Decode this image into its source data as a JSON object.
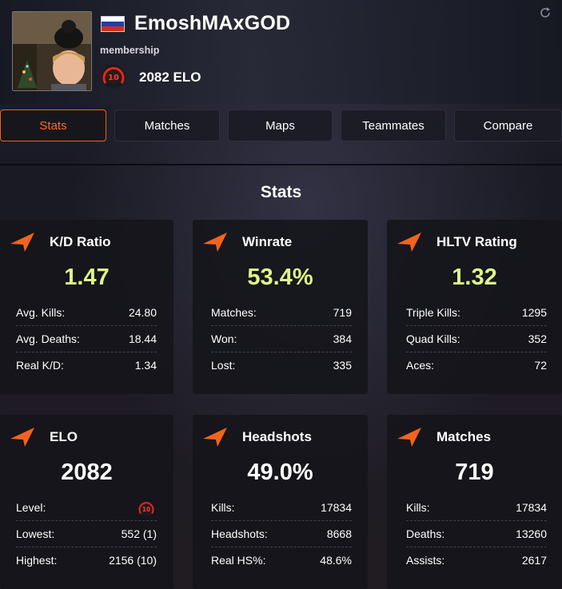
{
  "profile": {
    "nickname": "EmoshMAxGOD",
    "membership": "membership",
    "elo_display": "2082 ELO",
    "level": "10",
    "country": "russia"
  },
  "icons": {
    "refresh": "refresh-icon",
    "card": "faceit-arrow-icon"
  },
  "colors": {
    "accent": "#f2641c",
    "highlight_green": "#dff58a",
    "background": "#1c1c26"
  },
  "tabs": [
    {
      "label": "Stats",
      "active": true
    },
    {
      "label": "Matches",
      "active": false
    },
    {
      "label": "Maps",
      "active": false
    },
    {
      "label": "Teammates",
      "active": false
    },
    {
      "label": "Compare",
      "active": false
    }
  ],
  "section_title": "Stats",
  "cards": [
    {
      "title": "K/D Ratio",
      "value": "1.47",
      "rows": [
        {
          "label": "Avg. Kills:",
          "value": "24.80"
        },
        {
          "label": "Avg. Deaths:",
          "value": "18.44"
        },
        {
          "label": "Real K/D:",
          "value": "1.34"
        }
      ]
    },
    {
      "title": "Winrate",
      "value": "53.4%",
      "rows": [
        {
          "label": "Matches:",
          "value": "719"
        },
        {
          "label": "Won:",
          "value": "384"
        },
        {
          "label": "Lost:",
          "value": "335"
        }
      ]
    },
    {
      "title": "HLTV Rating",
      "value": "1.32",
      "rows": [
        {
          "label": "Triple Kills:",
          "value": "1295"
        },
        {
          "label": "Quad Kills:",
          "value": "352"
        },
        {
          "label": "Aces:",
          "value": "72"
        }
      ]
    },
    {
      "title": "ELO",
      "value": "2082",
      "rows": [
        {
          "label": "Level:",
          "value": "10"
        },
        {
          "label": "Lowest:",
          "value": "552 (1)"
        },
        {
          "label": "Highest:",
          "value": "2156 (10)"
        }
      ]
    },
    {
      "title": "Headshots",
      "value": "49.0%",
      "rows": [
        {
          "label": "Kills:",
          "value": "17834"
        },
        {
          "label": "Headshots:",
          "value": "8668"
        },
        {
          "label": "Real HS%:",
          "value": "48.6%"
        }
      ]
    },
    {
      "title": "Matches",
      "value": "719",
      "rows": [
        {
          "label": "Kills:",
          "value": "17834"
        },
        {
          "label": "Deaths:",
          "value": "13260"
        },
        {
          "label": "Assists:",
          "value": "2617"
        }
      ]
    }
  ]
}
